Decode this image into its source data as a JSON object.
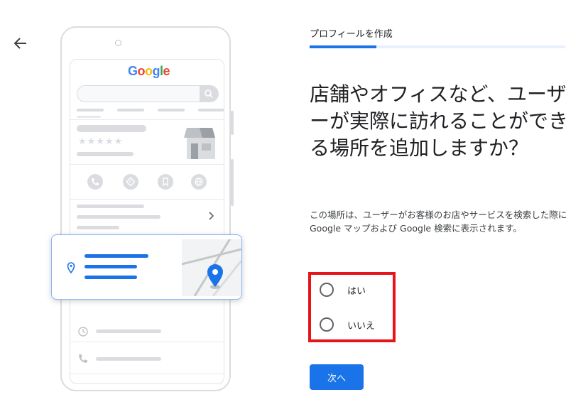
{
  "header": {
    "step_label": "プロフィールを作成",
    "progress_fraction": 0.26
  },
  "question": {
    "heading": "店舗やオフィスなど、ユーザーが実際に訪れることができる場所を追加しますか？",
    "description": "この場所は、ユーザーがお客様のお店やサービスを検索した際に Google マップおよび Google 検索に表示されます。"
  },
  "options": [
    {
      "label": "はい",
      "selected": false
    },
    {
      "label": "いいえ",
      "selected": false
    }
  ],
  "actions": {
    "next_label": "次へ"
  },
  "illustration": {
    "logo_letters": [
      "G",
      "o",
      "o",
      "g",
      "l",
      "e"
    ],
    "stars": "★★★★★"
  },
  "colors": {
    "primary": "#1a73e8",
    "highlight": "#e8141b",
    "progress_track": "#e8f0fe",
    "logo": [
      "#4285f4",
      "#ea4335",
      "#fbbc05",
      "#4285f4",
      "#34a853",
      "#ea4335"
    ]
  },
  "icons": {
    "back": "arrow-left-icon",
    "search": "search-icon",
    "phone": "phone-icon",
    "directions": "directions-icon",
    "bookmark": "bookmark-icon",
    "website": "globe-icon",
    "chevron": "chevron-right-icon",
    "location": "location-pin-icon",
    "clock": "clock-icon"
  }
}
